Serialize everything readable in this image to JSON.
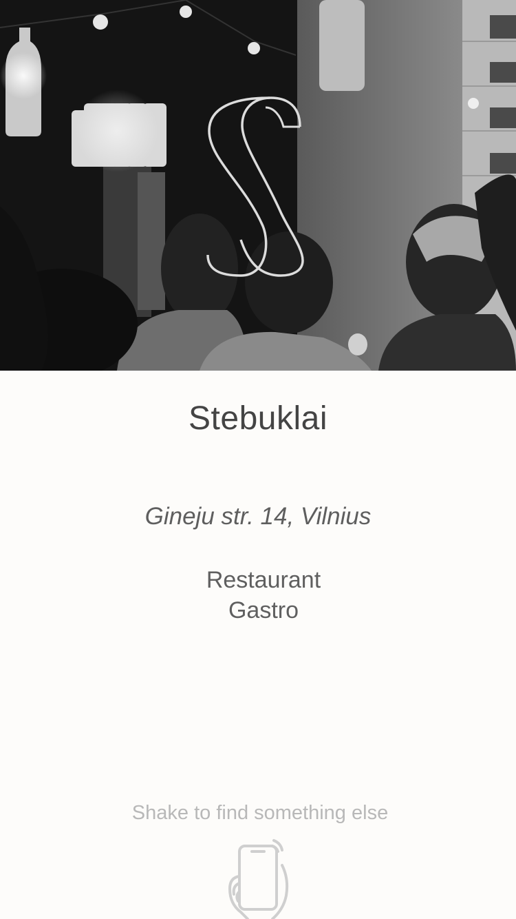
{
  "venue": {
    "name": "Stebuklai",
    "address": "Gineju str. 14, Vilnius",
    "categories": [
      "Restaurant",
      "Gastro"
    ]
  },
  "hero": {
    "image": "black-and-white-restaurant-interior-photo",
    "logo_icon": "s-monogram-logo"
  },
  "footer": {
    "hint": "Shake to find something else",
    "icon": "shake-phone-icon"
  },
  "colors": {
    "background": "#fdfcfa",
    "title": "#444444",
    "body_text": "#5f5f5f",
    "hint_text": "#b8b8b8"
  }
}
